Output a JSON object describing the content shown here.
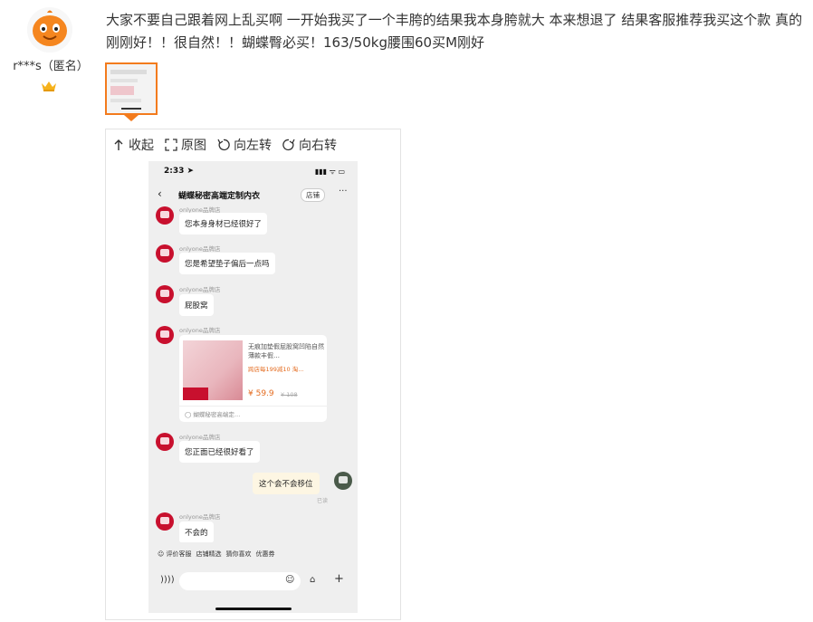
{
  "review": {
    "username": "r***s（匿名）",
    "text": "大家不要自己跟着网上乱买啊 一开始我买了一个丰胯的结果我本身胯就大 本来想退了 结果客服推荐我买这个款 真的刚刚好！！很自然！！蝴蝶臀必买！163/50kg腰围60买M刚好",
    "avatar_icon": "orange-mascot-avatar",
    "badge_icon": "crown-icon"
  },
  "viewer": {
    "toolbar": {
      "collapse_label": "收起",
      "original_label": "原图",
      "rotate_left_label": "向左转",
      "rotate_right_label": "向右转"
    }
  },
  "chat_screenshot": {
    "status_time": "2:33 ➤",
    "status_icons": "▮▮▮ ᯤ ▭",
    "title": "蝴蝶秘密高端定制内衣",
    "shop_button": "店铺",
    "more": "···",
    "back": "‹",
    "messages": [
      {
        "sender": "onlyone品牌店",
        "text": "您本身身材已经很好了"
      },
      {
        "sender": "onlyone品牌店",
        "text": "您是希望垫子偏后一点吗"
      },
      {
        "sender": "onlyone品牌店",
        "text": "屁股窝"
      },
      {
        "sender": "onlyone品牌店",
        "text": ""
      },
      {
        "sender": "onlyone品牌店",
        "text": "您正面已经很好看了"
      },
      {
        "sender": "onlyone品牌店",
        "text": "不会的"
      }
    ],
    "product_card": {
      "title": "无痕加垫假屁股窝凹陷自然薄款丰假…",
      "promo": "跨店每199减10  淘…",
      "price": "¥ 59.9",
      "old_price": "¥ 108",
      "shop": "◯ 蝴蝶秘密高端定…"
    },
    "user_message": "这个会不会移位",
    "read_status": "已读",
    "quick_replies": [
      "☺ 评价客服",
      "店铺精选",
      "猜你喜欢",
      "优惠券"
    ],
    "input_icons": {
      "voice": "))))",
      "emoji": "☺",
      "bag": "⌂",
      "plus": "+"
    }
  }
}
